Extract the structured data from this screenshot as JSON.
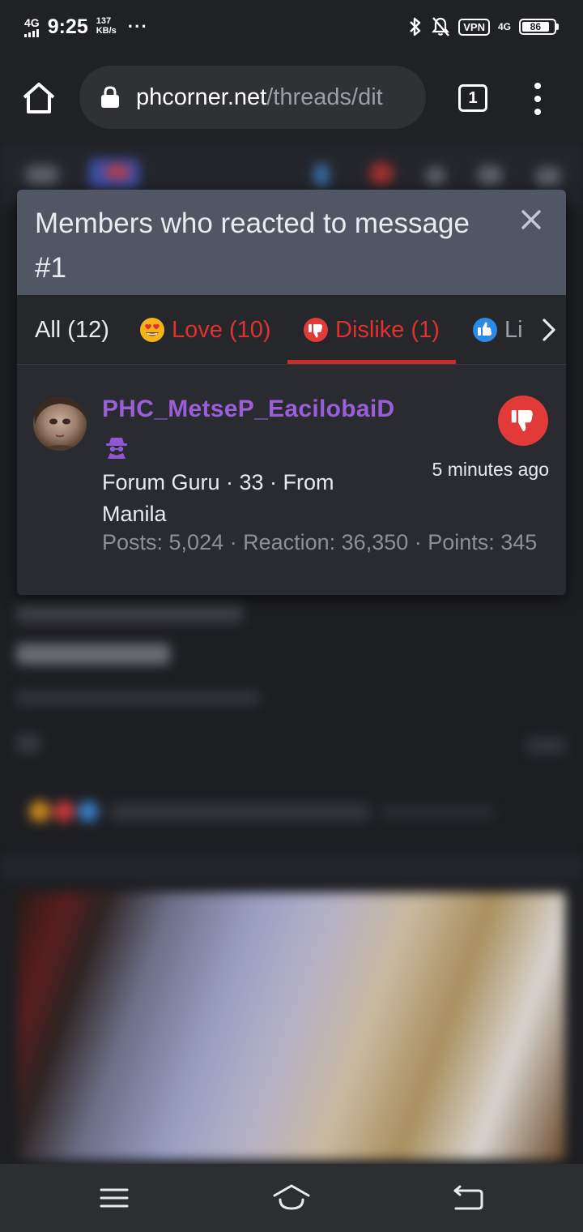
{
  "status_bar": {
    "network": "4G",
    "time": "9:25",
    "speed_value": "137",
    "speed_unit": "KB/s",
    "more": "···",
    "vpn": "VPN",
    "network_right": "4G",
    "battery": "86",
    "battery_level": 0.86
  },
  "browser": {
    "url_host": "phcorner.net",
    "url_path": "/threads/dit",
    "tab_count": "1"
  },
  "modal": {
    "title": "Members who reacted to message #1",
    "tabs": [
      {
        "label": "All (12)",
        "icon": "none",
        "active": false
      },
      {
        "label": "Love (10)",
        "icon": "heart-eyes-emoji-icon",
        "active": false
      },
      {
        "label": "Dislike (1)",
        "icon": "thumbs-down-icon",
        "active": true
      },
      {
        "label": "Li",
        "icon": "thumbs-up-icon",
        "active": false
      }
    ],
    "member": {
      "name": "PHC_MetseP_EacilobaiD",
      "title": "Forum Guru · 33 · From Manila",
      "stats": "Posts: 5,024 · Reaction: 36,350 · Points: 345",
      "reaction_time": "5 minutes ago",
      "reaction_icon": "thumbs-down-icon"
    }
  },
  "colors": {
    "accent_red": "#e0312f",
    "member_name": "#9a5ed9",
    "modal_header": "#505663"
  }
}
